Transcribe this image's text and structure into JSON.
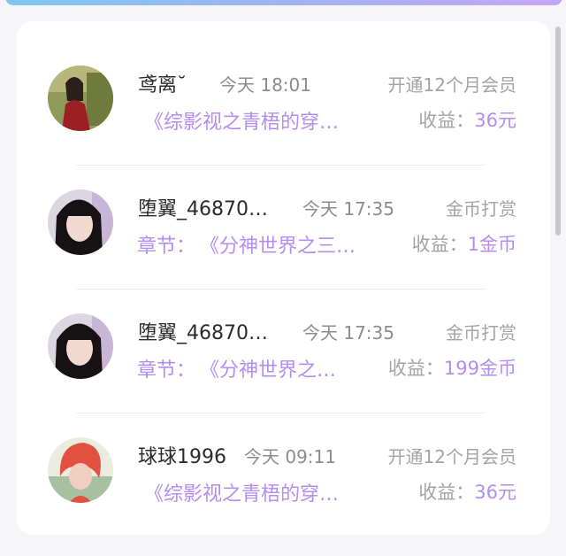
{
  "records": [
    {
      "name": "鸢离˘",
      "time": "今天 18:01",
      "type": "开通12个月会员",
      "prefix": "",
      "title": "《综影视之青梧的穿…",
      "earn_label": "收益：",
      "earn_amount": "36元",
      "avatar": "woman-red-dress-avatar"
    },
    {
      "name": "堕翼_46870…",
      "time": "今天 17:35",
      "type": "金币打赏",
      "prefix": "章节：",
      "title": "《分神世界之三…",
      "earn_label": "收益：",
      "earn_amount": "1金币",
      "avatar": "girl-portrait-avatar"
    },
    {
      "name": "堕翼_46870…",
      "time": "今天 17:35",
      "type": "金币打赏",
      "prefix": "章节：",
      "title": "《分神世界之…",
      "earn_label": "收益：",
      "earn_amount": "199金币",
      "avatar": "girl-portrait-avatar"
    },
    {
      "name": "球球1996",
      "time": "今天 09:11",
      "type": "开通12个月会员",
      "prefix": "",
      "title": "《综影视之青梧的穿…",
      "earn_label": "收益：",
      "earn_amount": "36元",
      "avatar": "red-hair-avatar"
    }
  ]
}
